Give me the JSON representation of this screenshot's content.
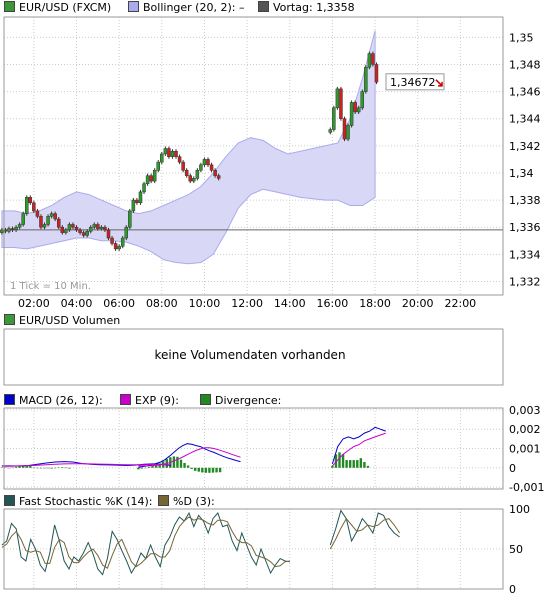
{
  "legends": {
    "price": [
      {
        "label": "EUR/USD (FXCM)",
        "color": "#3a9a3a"
      },
      {
        "label": "Bollinger (20, 2):",
        "value": "–",
        "color": "#aaaaee"
      },
      {
        "label": "Vortag: 1,3358",
        "color": "#555555"
      }
    ],
    "volume": [
      {
        "label": "EUR/USD Volumen",
        "color": "#3a9a3a"
      }
    ],
    "macd": [
      {
        "label": "MACD (26, 12):",
        "color": "#0000cc"
      },
      {
        "label": "EXP (9):",
        "color": "#cc00cc"
      },
      {
        "label": "Divergence:",
        "color": "#228822"
      }
    ],
    "stoch": [
      {
        "label": "Fast Stochastic %K (14):",
        "color": "#225555"
      },
      {
        "label": "%D (3):",
        "color": "#776633"
      }
    ]
  },
  "price_badge": "1,34672",
  "tick_note": "1 Tick = 10 Min.",
  "no_volume_text": "keine Volumendaten vorhanden",
  "colors": {
    "up": "#2e9a2e",
    "down": "#cc2222",
    "band": "#d8d8f6",
    "band_edge": "#aaaaee",
    "grid": "#cccccc"
  },
  "chart_data": [
    {
      "type": "candlestick",
      "title": "EUR/USD (FXCM)",
      "x_ticks": [
        "02:00",
        "04:00",
        "06:00",
        "08:00",
        "10:00",
        "12:00",
        "14:00",
        "16:00",
        "18:00",
        "20:00",
        "22:00"
      ],
      "y_ticks": [
        "1,35",
        "1,348",
        "1,346",
        "1,344",
        "1,342",
        "1,34",
        "1,338",
        "1,336",
        "1,334",
        "1,332"
      ],
      "ylim": [
        1.331,
        1.3515
      ],
      "xlim": [
        0.6,
        24
      ],
      "reference_line": 1.3358,
      "last_value": 1.34672,
      "segments": [
        {
          "start": 0.5,
          "closes": [
            1.3358,
            1.3357,
            1.3359,
            1.3358,
            1.336,
            1.3362,
            1.337,
            1.3382,
            1.3378,
            1.3372,
            1.3368,
            1.336,
            1.3362,
            1.3368,
            1.337,
            1.3366,
            1.336,
            1.3356,
            1.3358,
            1.3362,
            1.336,
            1.3358,
            1.3356,
            1.3354,
            1.3357,
            1.336,
            1.3362,
            1.3359,
            1.336,
            1.3358,
            1.3352,
            1.3348,
            1.3344,
            1.3346,
            1.3352,
            1.336,
            1.3372,
            1.338,
            1.3378,
            1.3386,
            1.3392,
            1.3398,
            1.3394,
            1.3402,
            1.3408,
            1.3414,
            1.3418,
            1.3412,
            1.3416,
            1.3412,
            1.3408,
            1.3402,
            1.3398,
            1.3394,
            1.3396,
            1.3402,
            1.3406,
            1.341,
            1.3406,
            1.3402,
            1.3398,
            1.3396
          ]
        },
        {
          "start": 15.9,
          "closes": [
            1.3432,
            1.3448,
            1.3462,
            1.344,
            1.3425,
            1.3435,
            1.3452,
            1.3445,
            1.3448,
            1.346,
            1.3478,
            1.3488,
            1.348,
            1.3467
          ]
        }
      ],
      "bollinger_upper": [
        1.3372,
        1.3372,
        1.337,
        1.3372,
        1.3376,
        1.3382,
        1.3386,
        1.3384,
        1.338,
        1.3376,
        1.3372,
        1.337,
        1.3372,
        1.3376,
        1.338,
        1.3384,
        1.339,
        1.34,
        1.3412,
        1.3422,
        1.3426,
        1.3424,
        1.3418,
        1.3414,
        1.3416,
        1.3418,
        1.342,
        1.3422,
        1.344,
        1.347,
        1.3505
      ],
      "bollinger_lower": [
        1.3345,
        1.3345,
        1.3344,
        1.3346,
        1.3348,
        1.335,
        1.3352,
        1.3352,
        1.335,
        1.335,
        1.3349,
        1.3346,
        1.3342,
        1.3336,
        1.3334,
        1.3333,
        1.3334,
        1.334,
        1.3356,
        1.3374,
        1.3384,
        1.3388,
        1.3386,
        1.3384,
        1.3382,
        1.3381,
        1.338,
        1.338,
        1.3376,
        1.3376,
        1.3382
      ],
      "bollinger_x_start": 0.5,
      "bollinger_x_end": 18.0
    },
    {
      "type": "bar",
      "title": "EUR/USD Volumen",
      "values": []
    },
    {
      "type": "line",
      "title": "MACD",
      "y_ticks": [
        "0,003",
        "0,002",
        "0,001",
        "0",
        "-0,001"
      ],
      "ylim": [
        -0.0011,
        0.0031
      ],
      "series": [
        {
          "name": "MACD (26, 12)",
          "segments": [
            {
              "start": 0.5,
              "values": [
                0.0001,
                0.0001,
                0.0001,
                0.00012,
                0.00018,
                0.00025,
                0.0003,
                0.00032,
                0.0003,
                0.00022,
                0.00018,
                0.00016,
                0.00015,
                0.00014,
                0.00012,
                0.00014,
                0.00018,
                0.0002,
                0.00018,
                0.00012
              ]
            },
            {
              "start": 6.9,
              "values": [
                2e-05,
                6e-05,
                0.0001,
                0.00015,
                0.00022,
                0.0003,
                0.00042,
                0.0006,
                0.0008,
                0.001,
                0.00115,
                0.00125,
                0.00122,
                0.00115,
                0.0011,
                0.00098,
                0.00088,
                0.0008,
                0.0007,
                0.0006,
                0.00052,
                0.00045,
                0.00038,
                0.00032
              ]
            },
            {
              "start": 16.0,
              "values": [
                0.0002,
                0.0011,
                0.0015,
                0.0016,
                0.0015,
                0.0016,
                0.0018,
                0.0019,
                0.0021,
                0.002,
                0.0019
              ]
            }
          ]
        },
        {
          "name": "EXP (9)",
          "segments": [
            {
              "start": 0.5,
              "values": [
                8e-05,
                8e-05,
                0.0001,
                0.00011,
                0.00013,
                0.00016,
                0.00018,
                0.0002,
                0.00021,
                0.00021,
                0.0002,
                0.00019,
                0.00018,
                0.00017,
                0.00016,
                0.00016,
                0.00016,
                0.00017,
                0.00017,
                0.00016
              ]
            },
            {
              "start": 6.9,
              "values": [
                0.0001,
                0.0001,
                0.0001,
                0.00011,
                0.00013,
                0.00016,
                0.0002,
                0.00026,
                0.00035,
                0.00045,
                0.00056,
                0.00068,
                0.0008,
                0.0009,
                0.00098,
                0.00104,
                0.00104,
                0.001,
                0.00094,
                0.00086,
                0.00078,
                0.0007,
                0.00062,
                0.00055
              ]
            },
            {
              "start": 16.0,
              "values": [
                0.0001,
                0.0004,
                0.0007,
                0.0009,
                0.0011,
                0.0012,
                0.0014,
                0.0015,
                0.0016,
                0.0017,
                0.0018
              ]
            }
          ]
        },
        {
          "name": "Divergence",
          "bars": [
            {
              "start": 0.5,
              "values": [
                2e-05,
                2e-05,
                0.0,
                1e-05,
                5e-05,
                9e-05,
                0.00012,
                0.00012,
                9e-05,
                1e-05,
                -2e-05,
                -3e-05,
                -3e-05,
                -3e-05,
                -4e-05,
                -2e-05,
                2e-05,
                3e-05,
                1e-05,
                -4e-05
              ]
            },
            {
              "start": 6.9,
              "values": [
                -8e-05,
                -4e-05,
                0.0,
                4e-05,
                9e-05,
                0.00014,
                0.00022,
                0.00034,
                0.00045,
                0.00055,
                0.00059,
                0.00057,
                0.00042,
                0.00025,
                0.00012,
                -6e-05,
                -0.00016,
                -0.0002,
                -0.00024,
                -0.00026,
                -0.00026,
                -0.00025,
                -0.00024,
                -0.00023
              ]
            },
            {
              "start": 16.0,
              "values": [
                0.0001,
                0.0007,
                0.0008,
                0.0007,
                0.0004,
                0.0004,
                0.0004,
                0.0004,
                0.0005,
                0.0003,
                0.0001
              ]
            }
          ]
        }
      ]
    },
    {
      "type": "line",
      "title": "Fast Stochastic",
      "y_ticks": [
        "100",
        "50",
        "0"
      ],
      "ylim": [
        0,
        100
      ],
      "series": [
        {
          "name": "Fast Stochastic %K (14)",
          "segments": [
            {
              "start": 0.5,
              "values": [
                55,
                60,
                82,
                75,
                40,
                35,
                62,
                50,
                30,
                22,
                45,
                80,
                60,
                35,
                25,
                40,
                35,
                45,
                58,
                44,
                25,
                18,
                38,
                72,
                62,
                48,
                35,
                20,
                30,
                45,
                38,
                55,
                40,
                28,
                55,
                65,
                80,
                90,
                85,
                95,
                78,
                92,
                85,
                70,
                88,
                95,
                78,
                80,
                60,
                48,
                70,
                55,
                40,
                30,
                50,
                35,
                20,
                30,
                38,
                35,
                34
              ]
            },
            {
              "start": 15.9,
              "values": [
                55,
                75,
                98,
                88,
                60,
                72,
                88,
                80,
                70,
                95,
                92,
                78,
                70,
                65
              ]
            }
          ]
        },
        {
          "name": "%D (3)",
          "segments": [
            {
              "start": 0.5,
              "values": [
                52,
                56,
                66,
                72,
                62,
                48,
                46,
                48,
                46,
                32,
                32,
                52,
                62,
                58,
                40,
                33,
                33,
                40,
                46,
                50,
                42,
                30,
                26,
                42,
                56,
                62,
                48,
                34,
                28,
                32,
                38,
                44,
                44,
                40,
                40,
                48,
                66,
                78,
                85,
                90,
                86,
                88,
                86,
                82,
                80,
                86,
                86,
                84,
                72,
                62,
                58,
                58,
                54,
                42,
                40,
                38,
                34,
                28,
                29,
                34,
                35
              ]
            },
            {
              "start": 15.9,
              "values": [
                50,
                62,
                76,
                88,
                80,
                72,
                74,
                80,
                78,
                80,
                86,
                88,
                80,
                70
              ]
            }
          ]
        }
      ]
    }
  ]
}
